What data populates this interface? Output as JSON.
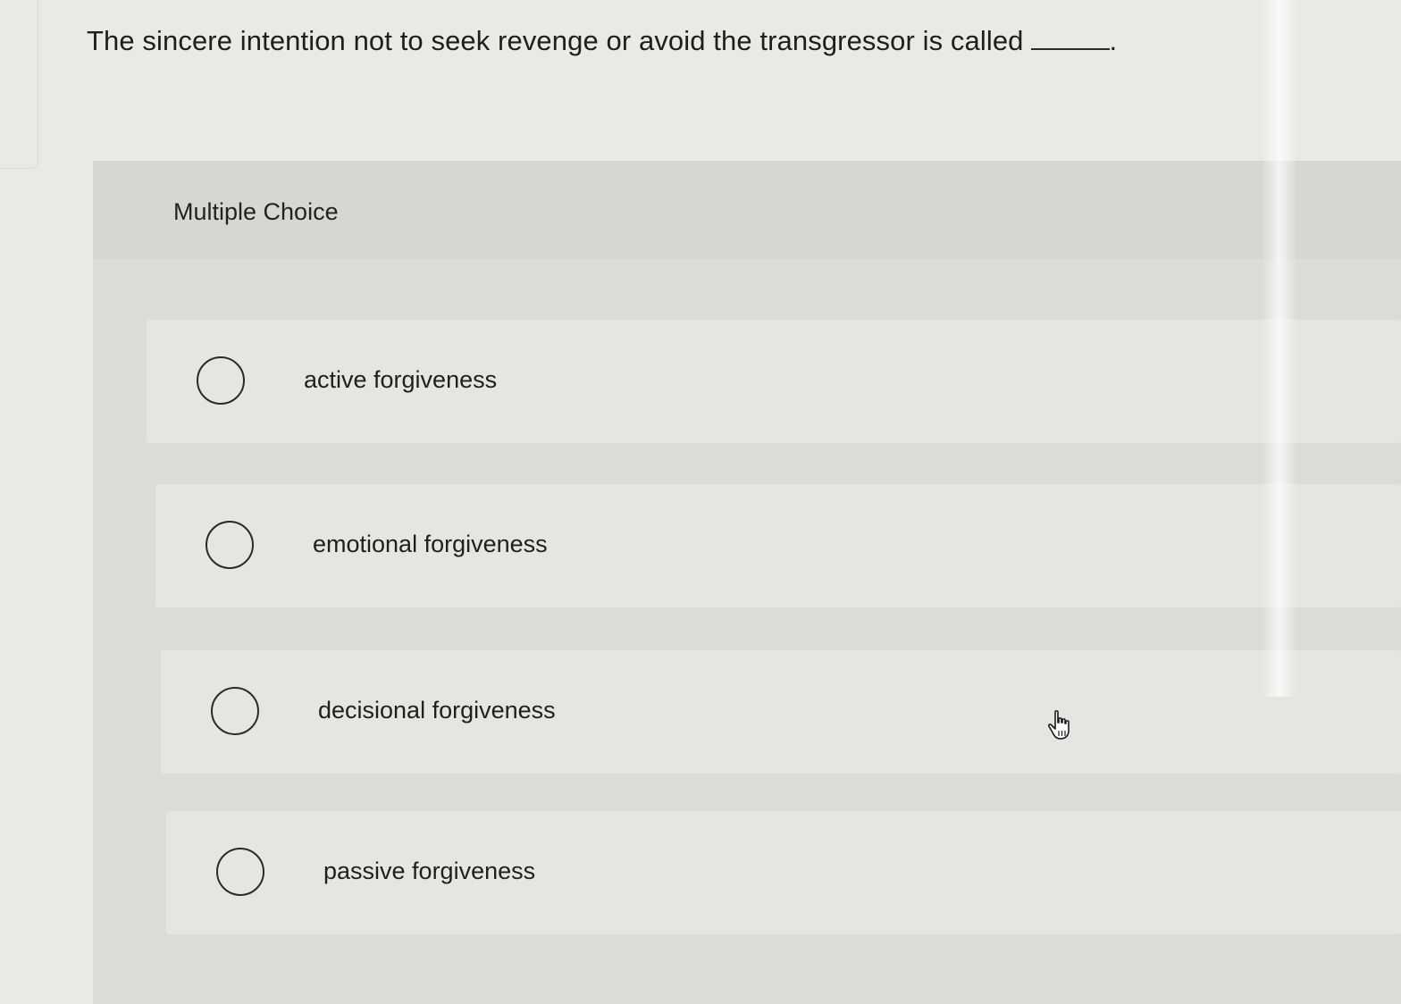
{
  "question": {
    "text": "The sincere intention not to seek revenge or avoid the transgressor is called",
    "end_punct": "."
  },
  "panel": {
    "label": "Multiple Choice"
  },
  "options": [
    {
      "label": "active forgiveness",
      "selected": false
    },
    {
      "label": "emotional forgiveness",
      "selected": false
    },
    {
      "label": "decisional forgiveness",
      "selected": false
    },
    {
      "label": "passive forgiveness",
      "selected": false
    }
  ],
  "cursor": {
    "icon": "hand-pointer-icon"
  }
}
